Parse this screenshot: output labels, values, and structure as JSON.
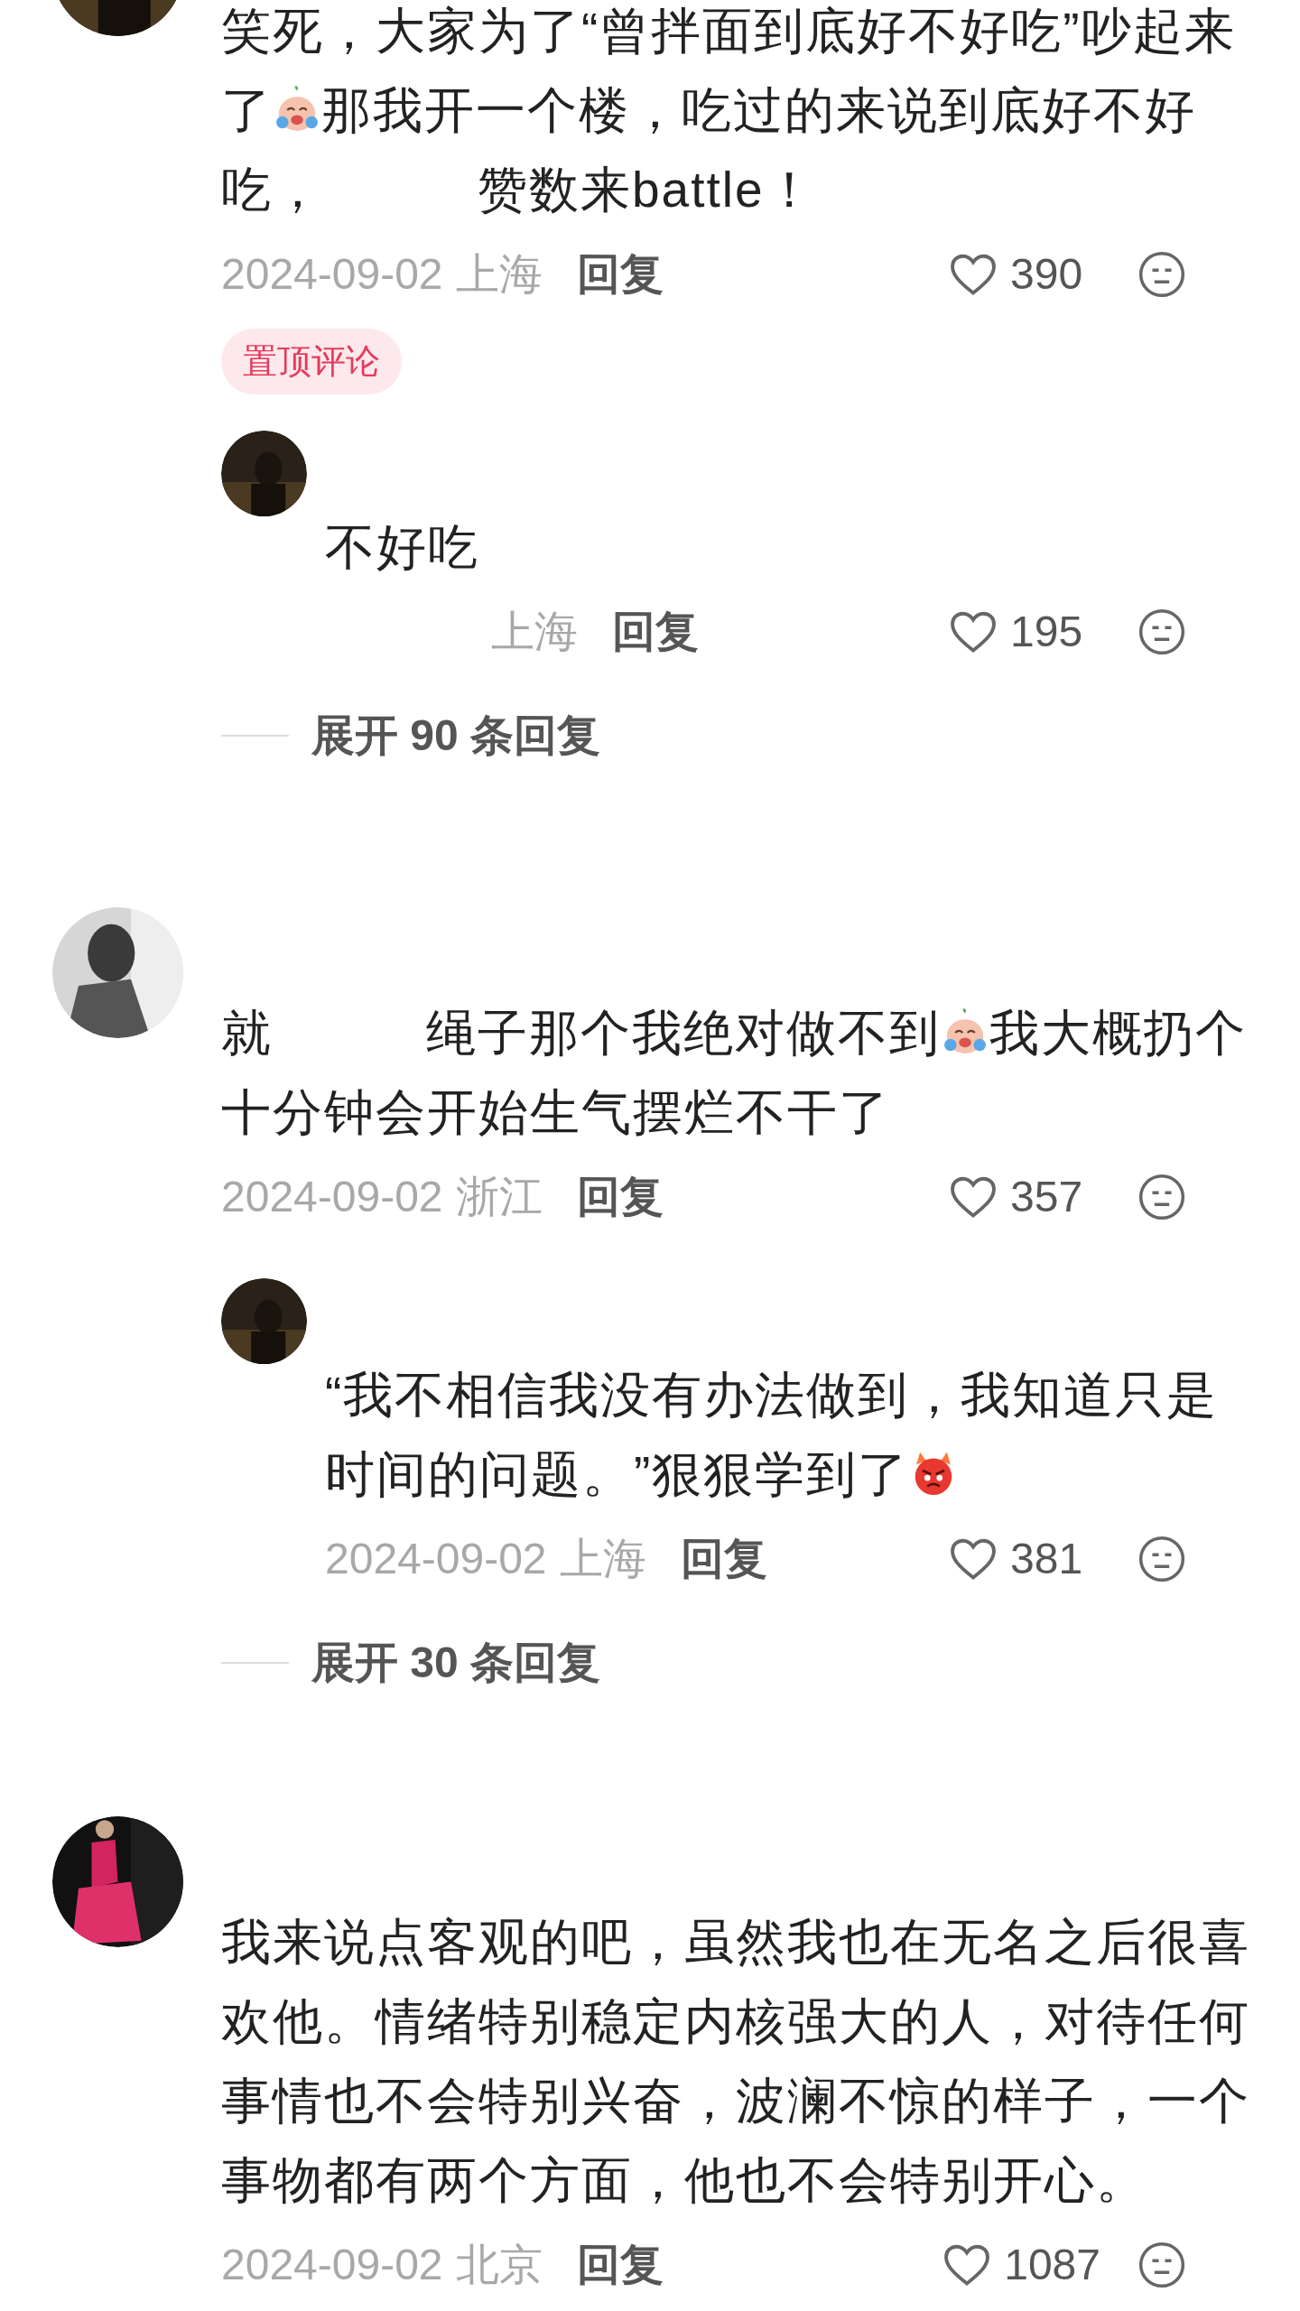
{
  "comments": [
    {
      "pinned_badge": "置顶评论",
      "text": [
        {
          "kind": "text",
          "value": "笑死，大家为了“曾拌面到底好不好吃”吵起来了"
        },
        {
          "kind": "crying_emoji"
        },
        {
          "kind": "text",
          "value": "那我开一个楼，吃过的来说到底好不好吃，"
        },
        {
          "kind": "redacted"
        },
        {
          "kind": "text",
          "value": "赞数来battle！"
        }
      ],
      "meta": {
        "date": "2024-09-02",
        "location": "上海",
        "reply": "回复",
        "likes": "390"
      },
      "replies": [
        {
          "text": [
            {
              "kind": "text",
              "value": "不好吃"
            }
          ],
          "meta": {
            "location": "上海",
            "reply": "回复",
            "likes": "195"
          }
        }
      ],
      "expand": "展开 90 条回复"
    },
    {
      "text": [
        {
          "kind": "text",
          "value": "就"
        },
        {
          "kind": "redacted"
        },
        {
          "kind": "text",
          "value": "绳子那个我绝对做不到"
        },
        {
          "kind": "crying_emoji"
        },
        {
          "kind": "text",
          "value": "我大概扔个十分钟会开始生气摆烂不干了"
        }
      ],
      "meta": {
        "date": "2024-09-02",
        "location": "浙江",
        "reply": "回复",
        "likes": "357"
      },
      "replies": [
        {
          "text": [
            {
              "kind": "text",
              "value": "“我不相信我没有办法做到，我知道只是时间的问题。”狠狠学到了"
            },
            {
              "kind": "angry_emoji"
            }
          ],
          "meta": {
            "date": "2024-09-02",
            "location": "上海",
            "reply": "回复",
            "likes": "381"
          }
        }
      ],
      "expand": "展开 30 条回复"
    },
    {
      "text": [
        {
          "kind": "text",
          "value": "我来说点客观的吧，虽然我也在无名之后很喜欢他。情绪特别稳定内核强大的人，对待任何事情也不会特别兴奋，波澜不惊的样子，一个事物都有两个方面，他也不会特别开心。"
        }
      ],
      "meta": {
        "date": "2024-09-02",
        "location": "北京",
        "reply": "回复",
        "likes": "1087"
      }
    }
  ]
}
